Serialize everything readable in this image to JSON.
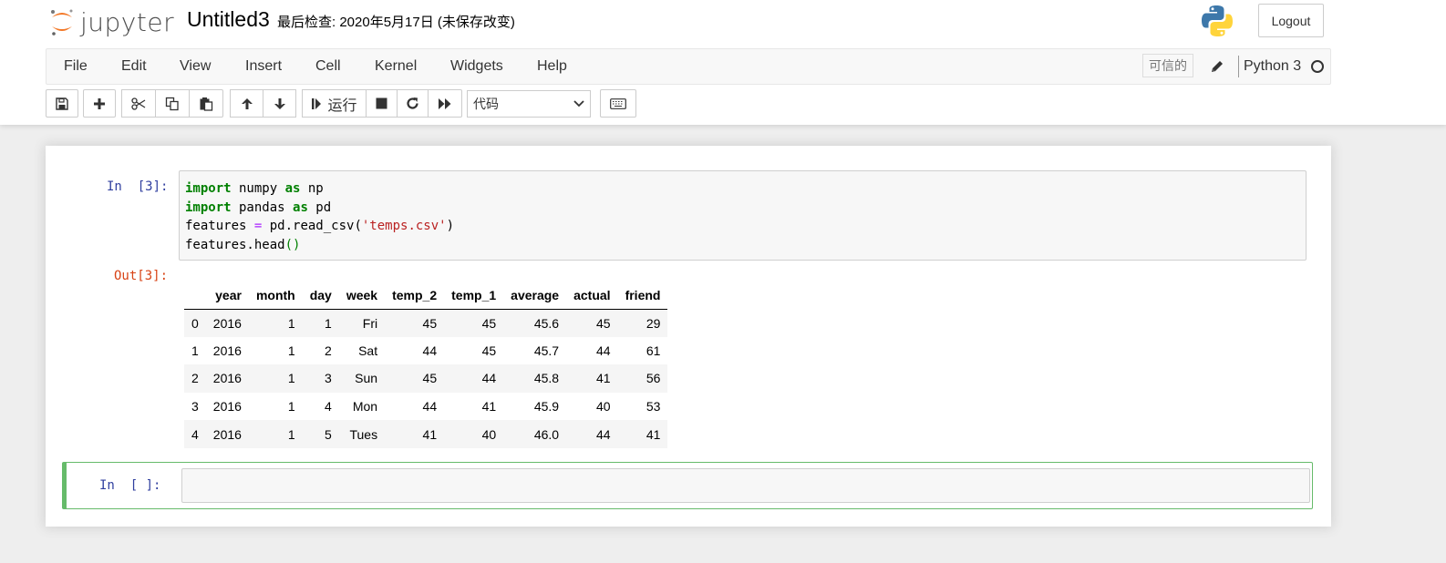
{
  "header": {
    "logo_text": "jupyter",
    "notebook_title": "Untitled3",
    "checkpoint": "最后检查: 2020年5月17日  (未保存改变)",
    "logout_label": "Logout"
  },
  "menubar": {
    "items": [
      "File",
      "Edit",
      "View",
      "Insert",
      "Cell",
      "Kernel",
      "Widgets",
      "Help"
    ],
    "trusted_label": "可信的",
    "kernel_name": "Python 3"
  },
  "toolbar": {
    "run_label": "运行",
    "cell_type_selected": "代码"
  },
  "cells": {
    "cell1": {
      "in_prompt": "In  [3]:",
      "out_prompt": "Out[3]:",
      "code": {
        "line1": {
          "kw1": "import",
          "mod": " numpy ",
          "kw2": "as",
          "alias": " np"
        },
        "line2": {
          "kw1": "import",
          "mod": " pandas ",
          "kw2": "as",
          "alias": " pd"
        },
        "line3": {
          "var": "features ",
          "op": "=",
          "call": " pd.read_csv(",
          "str": "'temps.csv'",
          "close": ")"
        },
        "line4": {
          "call": "features.head",
          "paren": "()"
        }
      },
      "output_table": {
        "columns": [
          "",
          "year",
          "month",
          "day",
          "week",
          "temp_2",
          "temp_1",
          "average",
          "actual",
          "friend"
        ],
        "rows": [
          [
            "0",
            "2016",
            "1",
            "1",
            "Fri",
            "45",
            "45",
            "45.6",
            "45",
            "29"
          ],
          [
            "1",
            "2016",
            "1",
            "2",
            "Sat",
            "44",
            "45",
            "45.7",
            "44",
            "61"
          ],
          [
            "2",
            "2016",
            "1",
            "3",
            "Sun",
            "45",
            "44",
            "45.8",
            "41",
            "56"
          ],
          [
            "3",
            "2016",
            "1",
            "4",
            "Mon",
            "44",
            "41",
            "45.9",
            "40",
            "53"
          ],
          [
            "4",
            "2016",
            "1",
            "5",
            "Tues",
            "41",
            "40",
            "46.0",
            "44",
            "41"
          ]
        ]
      }
    },
    "cell2": {
      "in_prompt": "In  [ ]:"
    }
  }
}
